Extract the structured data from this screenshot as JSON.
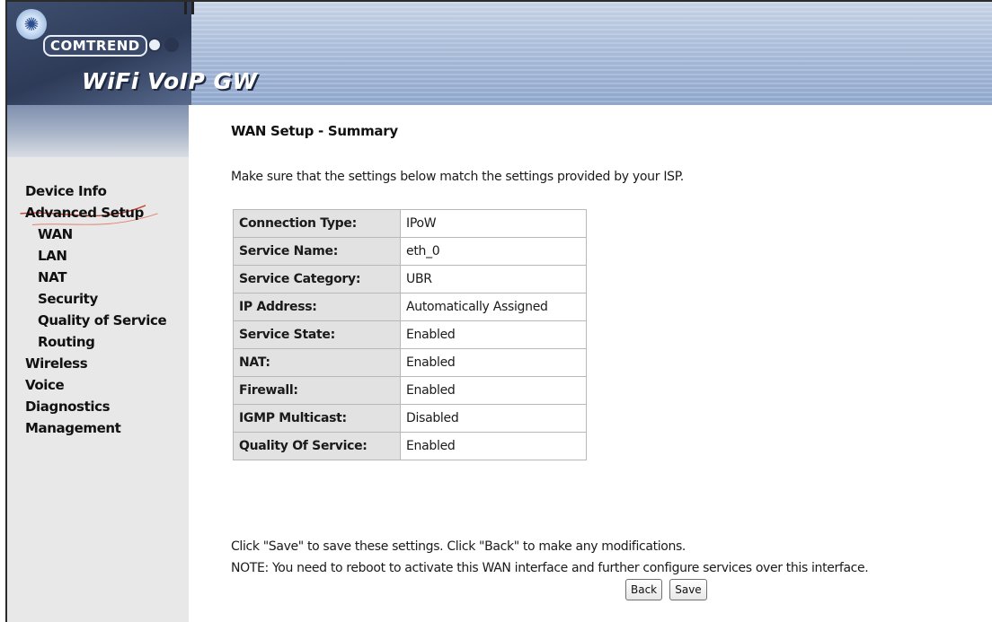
{
  "header": {
    "brand": "COMTREND",
    "product": "WiFi VoIP GW"
  },
  "sidebar": {
    "items": [
      {
        "label": "Device Info",
        "level": 0
      },
      {
        "label": "Advanced Setup",
        "level": 0
      },
      {
        "label": "WAN",
        "level": 1
      },
      {
        "label": "LAN",
        "level": 1
      },
      {
        "label": "NAT",
        "level": 1
      },
      {
        "label": "Security",
        "level": 1
      },
      {
        "label": "Quality of Service",
        "level": 1
      },
      {
        "label": "Routing",
        "level": 1
      },
      {
        "label": "Wireless",
        "level": 0
      },
      {
        "label": "Voice",
        "level": 0
      },
      {
        "label": "Diagnostics",
        "level": 0
      },
      {
        "label": "Management",
        "level": 0
      }
    ]
  },
  "main": {
    "title": "WAN Setup - Summary",
    "intro": "Make sure that the settings below match the settings provided by your ISP.",
    "summary": [
      {
        "label": "Connection Type:",
        "value": "IPoW"
      },
      {
        "label": "Service Name:",
        "value": "eth_0"
      },
      {
        "label": "Service Category:",
        "value": "UBR"
      },
      {
        "label": "IP Address:",
        "value": "Automatically Assigned"
      },
      {
        "label": "Service State:",
        "value": "Enabled"
      },
      {
        "label": "NAT:",
        "value": "Enabled"
      },
      {
        "label": "Firewall:",
        "value": "Enabled"
      },
      {
        "label": "IGMP Multicast:",
        "value": "Disabled"
      },
      {
        "label": "Quality Of Service:",
        "value": "Enabled"
      }
    ],
    "note_line1": "Click \"Save\" to save these settings. Click \"Back\" to make any modifications.",
    "note_line2": "NOTE: You need to reboot to activate this WAN interface and further configure services over this interface.",
    "back_label": "Back",
    "save_label": "Save"
  }
}
